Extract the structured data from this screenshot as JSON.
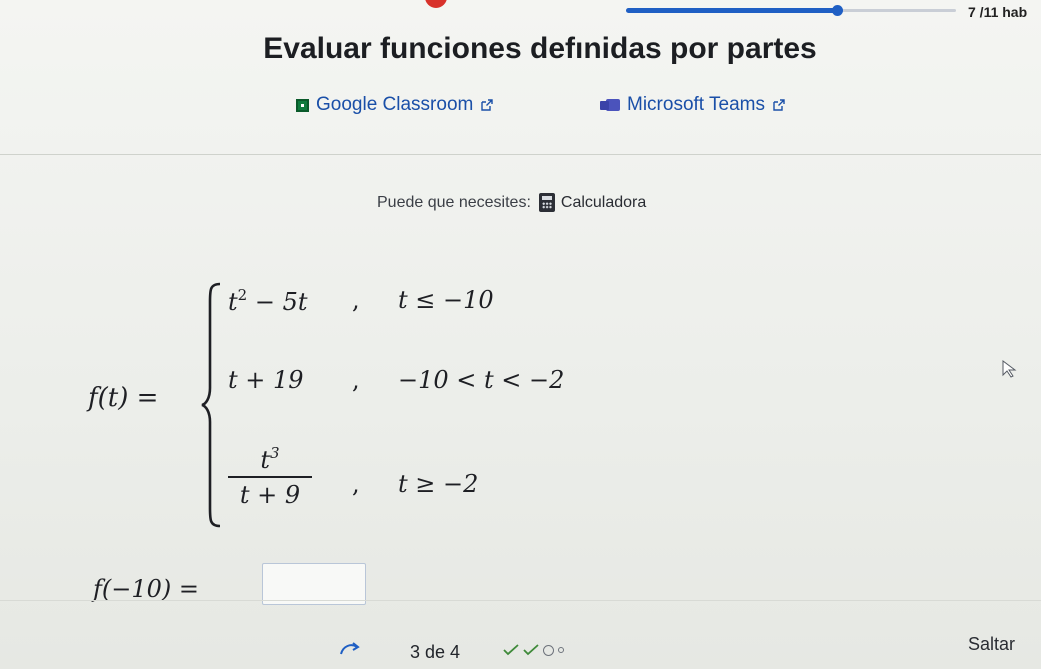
{
  "header": {
    "progress": {
      "current": 7,
      "total": 11,
      "fraction": 0.64,
      "label": "7 /11 hab"
    }
  },
  "title": "Evaluar funciones defınidas por partes",
  "share": {
    "google": {
      "label": "Google Classroom",
      "icon": "google-classroom-icon",
      "color": "#0f7b3d"
    },
    "teams": {
      "label": "Microsoft Teams",
      "icon": "microsoft-teams-icon",
      "color": "#4b53bc"
    }
  },
  "tools": {
    "prompt": "Puede que necesites:",
    "calculator": "Calculadora"
  },
  "problem": {
    "function_lhs": "f(t) =",
    "pieces": [
      {
        "expr_base": "t",
        "expr_exp": "2",
        "expr_tail": " − 5t",
        "sep": ",",
        "cond": "t ≤ −10"
      },
      {
        "expr": "t + 19",
        "sep": ",",
        "cond": "−10 < t < −2"
      },
      {
        "numerator_base": "t",
        "numerator_exp": "3",
        "denominator": "t + 9",
        "sep": ",",
        "cond": "t ≥ −2"
      }
    ],
    "question": "f(−10) =",
    "answer_value": ""
  },
  "footer": {
    "step_label": "3 de 4",
    "attempts": [
      "correct",
      "correct",
      "pending",
      "pending"
    ],
    "skip_label": "Saltar"
  },
  "colors": {
    "accent": "#1f5fc4",
    "link": "#1a4fa8",
    "alert": "#d8322b"
  }
}
